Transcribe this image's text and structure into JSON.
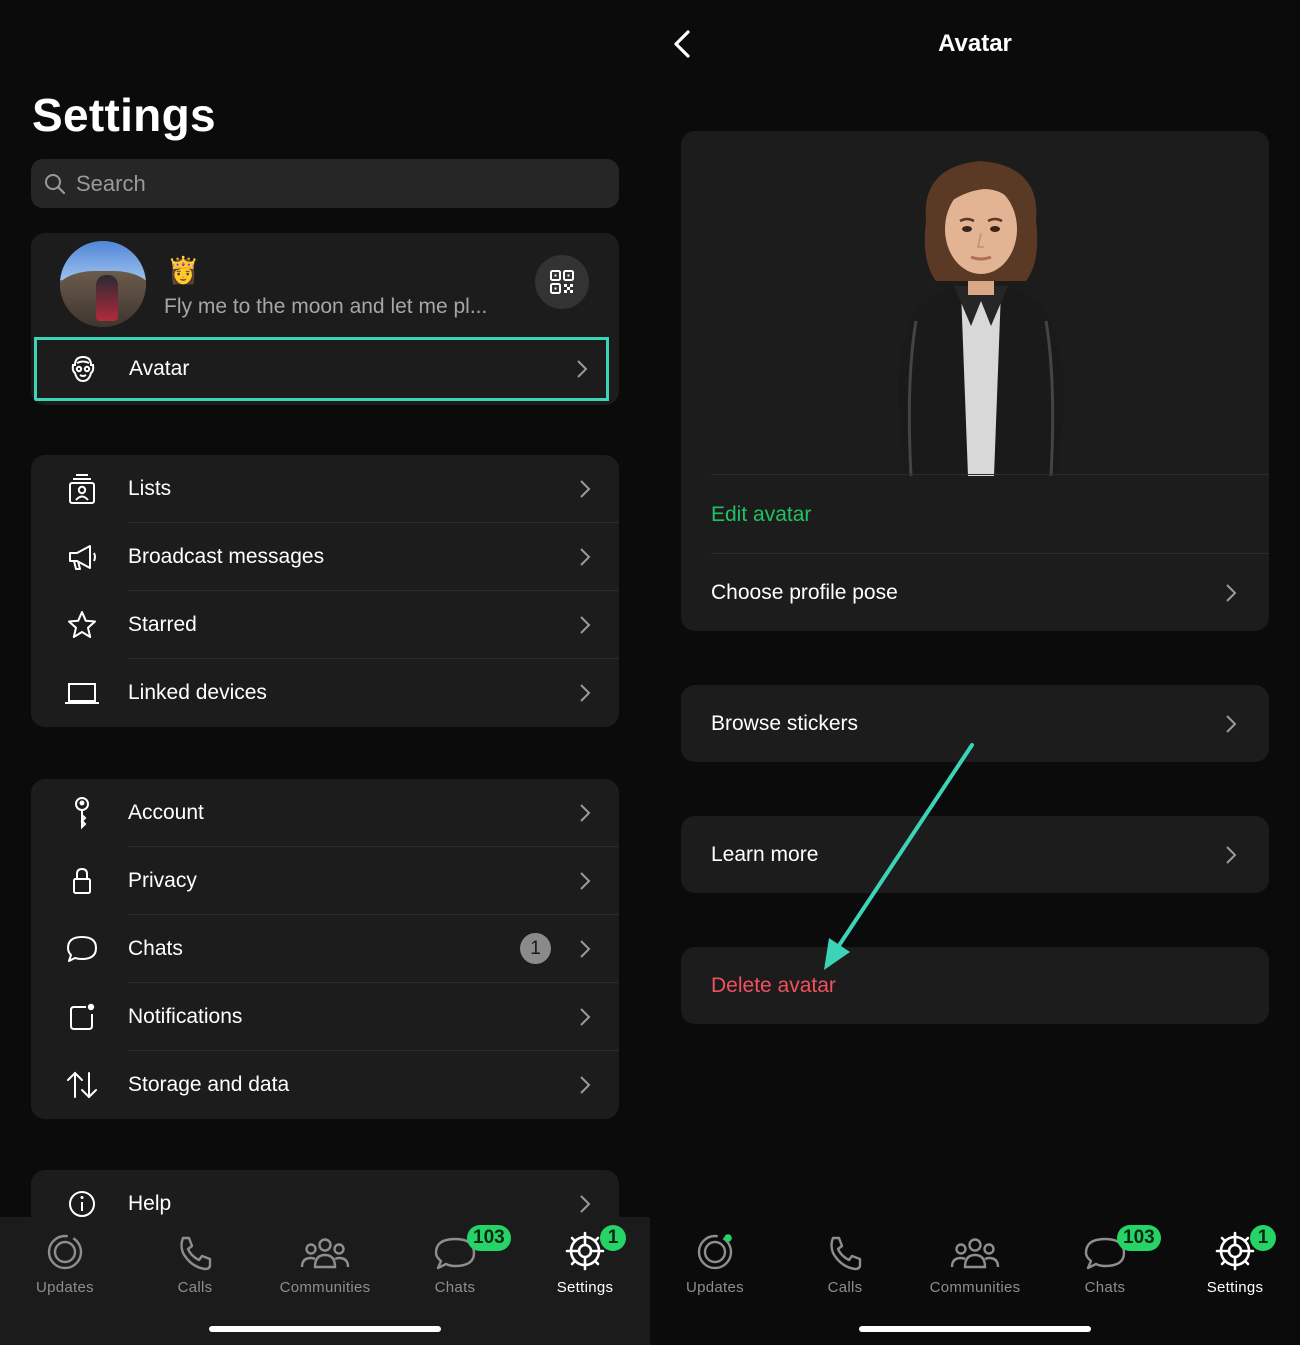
{
  "left": {
    "title": "Settings",
    "search": {
      "placeholder": "Search"
    },
    "profile": {
      "status_emoji": "👸",
      "about": "Fly me to the moon and let me pl...",
      "avatar_label": "Avatar"
    },
    "group1": [
      {
        "label": "Lists",
        "icon": "lists-icon"
      },
      {
        "label": "Broadcast messages",
        "icon": "megaphone-icon"
      },
      {
        "label": "Starred",
        "icon": "star-icon"
      },
      {
        "label": "Linked devices",
        "icon": "laptop-icon"
      }
    ],
    "group2": [
      {
        "label": "Account",
        "icon": "key-icon"
      },
      {
        "label": "Privacy",
        "icon": "lock-icon"
      },
      {
        "label": "Chats",
        "icon": "chat-bubble-icon",
        "badge": "1"
      },
      {
        "label": "Notifications",
        "icon": "notification-icon"
      },
      {
        "label": "Storage and data",
        "icon": "storage-arrows-icon"
      }
    ],
    "group3": [
      {
        "label": "Help",
        "icon": "info-icon"
      }
    ]
  },
  "right": {
    "title": "Avatar",
    "edit_avatar": "Edit avatar",
    "choose_pose": "Choose profile pose",
    "browse_stickers": "Browse stickers",
    "learn_more": "Learn more",
    "delete_avatar": "Delete avatar"
  },
  "nav": {
    "updates": "Updates",
    "calls": "Calls",
    "communities": "Communities",
    "chats": "Chats",
    "chats_badge": "103",
    "settings": "Settings",
    "settings_badge": "1"
  },
  "colors": {
    "accent_green": "#21c063",
    "badge_green": "#25d366",
    "highlight_teal": "#3cd3b6",
    "delete_red": "#f1515e"
  }
}
